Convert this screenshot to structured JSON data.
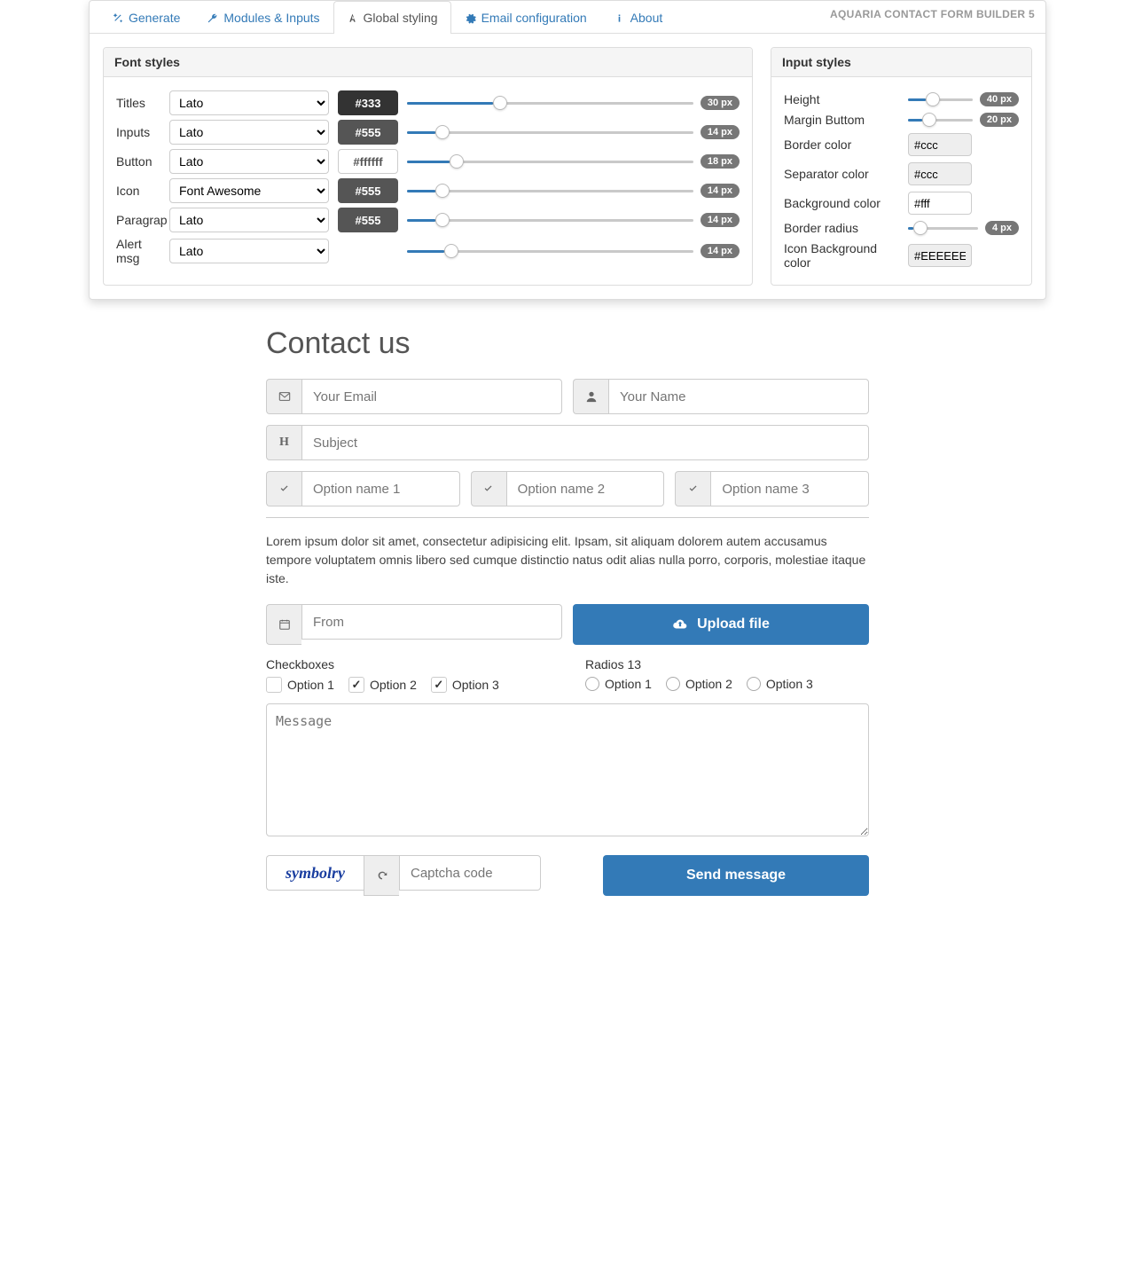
{
  "brand": "AQUARIA CONTACT FORM BUILDER 5",
  "tabs": {
    "generate": "Generate",
    "modules": "Modules & Inputs",
    "global": "Global styling",
    "email": "Email configuration",
    "about": "About"
  },
  "font_card": {
    "title": "Font styles",
    "rows": [
      {
        "label": "Titles",
        "font": "Lato",
        "color": "#333",
        "colorClass": "darker",
        "px": "30 px",
        "fill": 30
      },
      {
        "label": "Inputs",
        "font": "Lato",
        "color": "#555",
        "colorClass": "dark",
        "px": "14 px",
        "fill": 10
      },
      {
        "label": "Button",
        "font": "Lato",
        "color": "#ffffff",
        "colorClass": "white",
        "px": "18 px",
        "fill": 15
      },
      {
        "label": "Icon",
        "font": "Font Awesome",
        "color": "#555",
        "colorClass": "dark",
        "px": "14 px",
        "fill": 10
      },
      {
        "label": "Paragrap",
        "font": "Lato",
        "color": "#555",
        "colorClass": "dark",
        "px": "14 px",
        "fill": 10
      },
      {
        "label": "Alert msg",
        "font": "Lato",
        "color": "",
        "colorClass": "",
        "px": "14 px",
        "fill": 13
      }
    ]
  },
  "input_card": {
    "title": "Input styles",
    "height": {
      "label": "Height",
      "px": "40 px",
      "fill": 28
    },
    "margin": {
      "label": "Margin Buttom",
      "px": "20 px",
      "fill": 22
    },
    "border_color": {
      "label": "Border color",
      "value": "#ccc",
      "gray": true
    },
    "sep_color": {
      "label": "Separator color",
      "value": "#ccc",
      "gray": true
    },
    "bg_color": {
      "label": "Background color",
      "value": "#fff",
      "gray": false
    },
    "radius": {
      "label": "Border radius",
      "px": "4 px",
      "fill": 8
    },
    "icon_bg": {
      "label": "Icon Background color",
      "value": "#EEEEEE",
      "gray": true
    }
  },
  "preview": {
    "heading": "Contact us",
    "email_ph": "Your Email",
    "name_ph": "Your Name",
    "subject_ph": "Subject",
    "opt1": "Option name 1",
    "opt2": "Option name 2",
    "opt3": "Option name 3",
    "paragraph": "Lorem ipsum dolor sit amet, consectetur adipisicing elit. Ipsam, sit aliquam dolorem autem accusamus tempore voluptatem omnis libero sed cumque distinctio natus odit alias nulla porro, corporis, molestiae itaque iste.",
    "date_ph": "From",
    "upload": "Upload file",
    "cb_title": "Checkboxes",
    "cb1": "Option 1",
    "cb2": "Option 2",
    "cb3": "Option 3",
    "rb_title": "Radios 13",
    "rb1": "Option 1",
    "rb2": "Option 2",
    "rb3": "Option 3",
    "msg_ph": "Message",
    "captcha_text": "symbolry",
    "captcha_ph": "Captcha code",
    "send": "Send message"
  }
}
